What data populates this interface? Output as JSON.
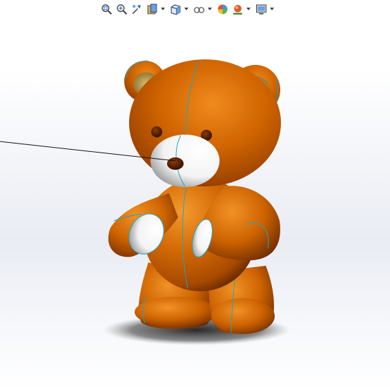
{
  "toolbar": {
    "icons": [
      "zoom-to-fit-icon",
      "zoom-to-area-icon",
      "previous-view-icon",
      "section-view-icon",
      "view-orientation-icon",
      "display-style-icon",
      "hide-show-items-icon",
      "edit-appearance-icon",
      "apply-scene-icon",
      "view-settings-icon"
    ]
  },
  "colors": {
    "bear_body": "#c45a00",
    "bear_highlight": "#f08a1e",
    "bear_shadow": "#6a2a00",
    "snout": "#ffffff",
    "edge_lines": "#1aa6c8",
    "floor_shadow": "#2a2a2a",
    "background": "#eef1f6"
  },
  "viewport": {
    "model": "teddy-bear"
  }
}
